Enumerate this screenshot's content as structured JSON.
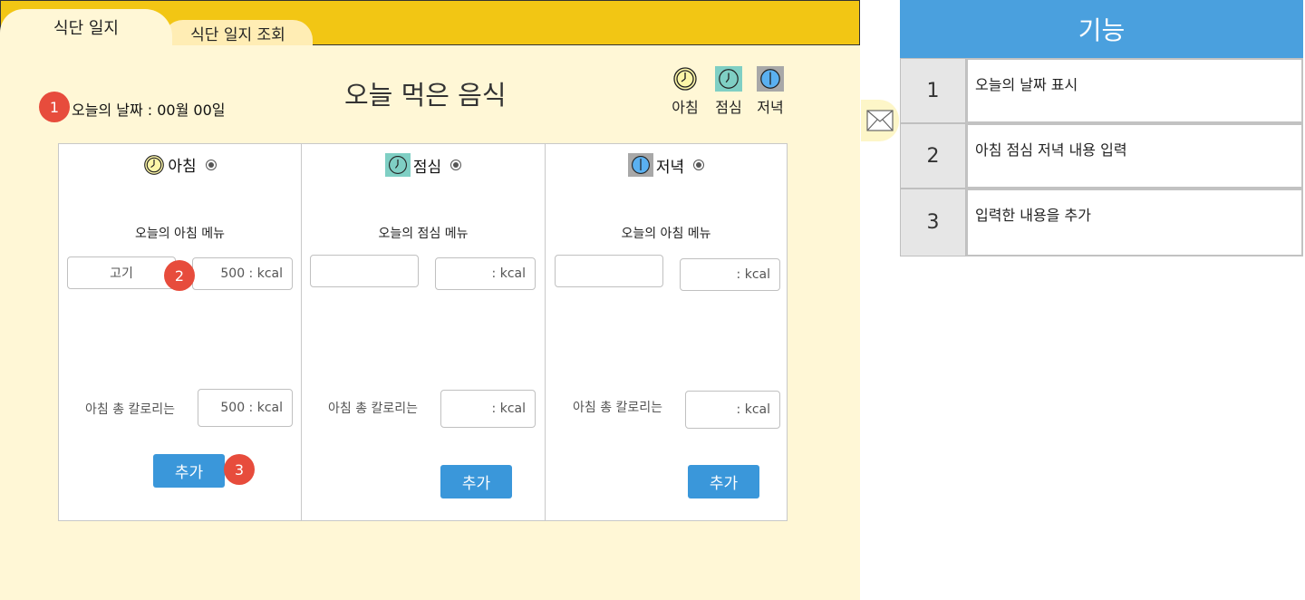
{
  "tabs": {
    "active": "식단 일지",
    "inactive": "식단 일지 조회"
  },
  "badges": [
    "1",
    "2",
    "3"
  ],
  "date_text": "오늘의 날짜 : 00월 00일",
  "page_title": "오늘 먹은 음식",
  "legend": [
    {
      "label": "아침",
      "color": "#fdf6a8"
    },
    {
      "label": "점심",
      "color": "#7fcfc4"
    },
    {
      "label": "저녁",
      "color": "#a8a8a8"
    }
  ],
  "columns": [
    {
      "meal": "아침",
      "menu_label": "오늘의 아침 메뉴",
      "food_value": "고기",
      "kcal_value": "500 : kcal",
      "total_label": "아침 총 칼로리는",
      "total_value": "500 : kcal",
      "button": "추가"
    },
    {
      "meal": "점심",
      "menu_label": "오늘의 점심 메뉴",
      "food_value": "",
      "kcal_value": ": kcal",
      "total_label": "아침 총 칼로리는",
      "total_value": ": kcal",
      "button": "추가"
    },
    {
      "meal": "저녁",
      "menu_label": "오늘의 아침 메뉴",
      "food_value": "",
      "kcal_value": ": kcal",
      "total_label": "아침 총 칼로리는",
      "total_value": ": kcal",
      "button": "추가"
    }
  ],
  "spec": {
    "title": "기능",
    "rows": [
      {
        "num": "1",
        "desc": "오늘의 날짜 표시"
      },
      {
        "num": "2",
        "desc": "아침 점심 저녁 내용 입력"
      },
      {
        "num": "3",
        "desc": "입력한 내용을 추가"
      }
    ]
  },
  "colors": {
    "topbar": "#f2c614",
    "background": "#fff7d6",
    "accent": "#3a97da",
    "badge": "#e74c3c"
  }
}
